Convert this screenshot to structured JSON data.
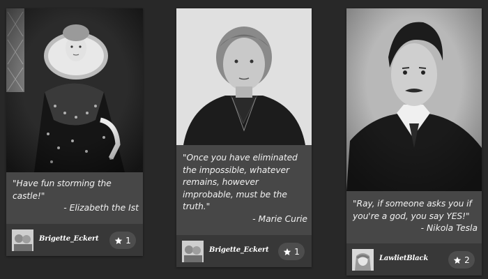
{
  "cards": [
    {
      "quote": "\"Have fun storming the castle!\"",
      "author": "- Elizabeth the Ist",
      "user": "Brigette_Eckert",
      "favorites": "1",
      "icon": "star-icon"
    },
    {
      "quote": "\"Once you have eliminated the impossible, whatever remains, however improbable, must be the truth.\"",
      "author": "- Marie Curie",
      "user": "Brigette_Eckert",
      "favorites": "1",
      "icon": "star-icon"
    },
    {
      "quote": "\"Ray, if someone asks you if you're a god, you say YES!\"",
      "author": "- Nikola Tesla",
      "user": "LawlietBlack",
      "favorites": "2",
      "icon": "star-icon"
    }
  ],
  "colors": {
    "background": "#282828",
    "card": "#474747",
    "footer": "#383838",
    "badge": "#4d4d4d",
    "text": "#f2f2f2"
  }
}
